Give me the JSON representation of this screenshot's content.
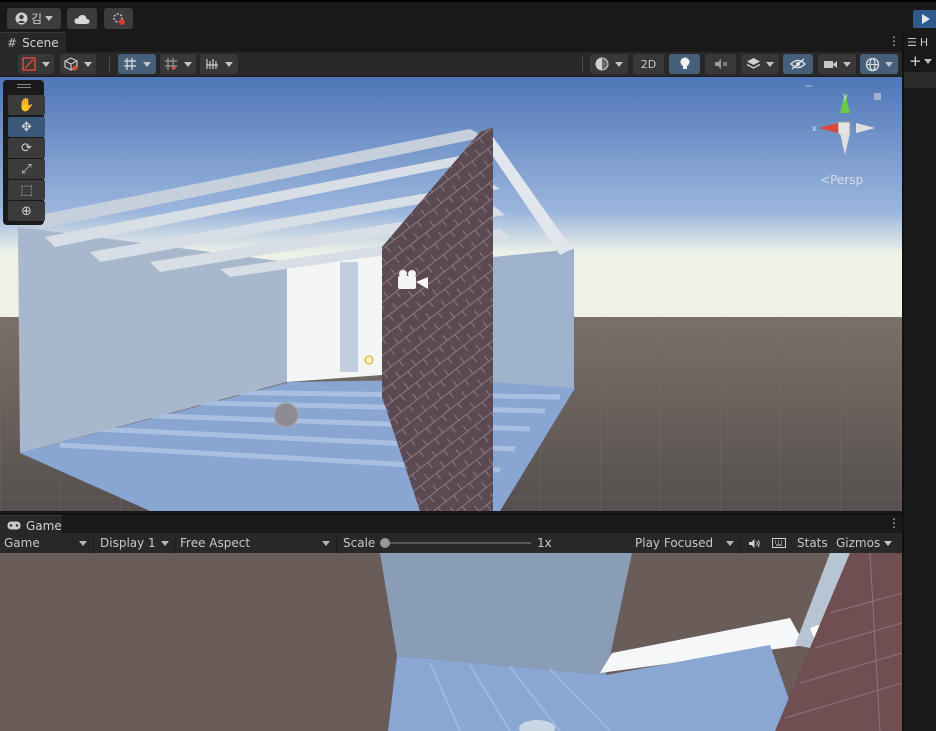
{
  "topbar": {
    "account_label": "김",
    "cloud_icon": "cloud-icon",
    "collab_icon": "collab-icon"
  },
  "scene_tab": {
    "title": "Scene",
    "buttons": {
      "two_d": "2D"
    },
    "gizmo": {
      "persp_label": "Persp",
      "axis_y": "y",
      "axis_x": "x"
    }
  },
  "tools": [
    "hand",
    "move",
    "rotate",
    "scale",
    "rect",
    "transform"
  ],
  "game_tab": {
    "title": "Game",
    "game_dropdown": "Game",
    "display_dropdown": "Display 1",
    "aspect_dropdown": "Free Aspect",
    "scale_label": "Scale",
    "scale_value": "1x",
    "scale_level": 0,
    "play_mode_dropdown": "Play Focused",
    "stats_label": "Stats",
    "gizmos_label": "Gizmos"
  },
  "hierarchy": {
    "title": "H",
    "add_label": "+"
  },
  "colors": {
    "accent": "#2f5a8c",
    "active_button": "#46607c",
    "panel": "#282828",
    "background": "#191919"
  }
}
